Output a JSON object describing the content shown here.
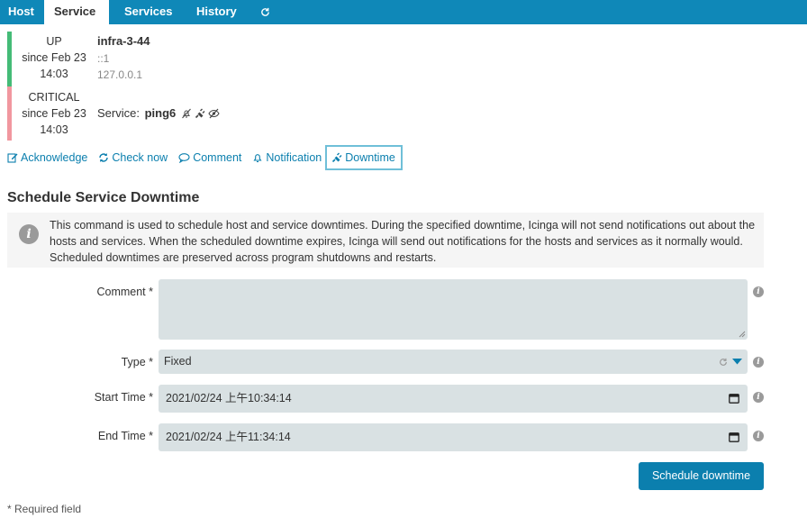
{
  "tabs": {
    "host": "Host",
    "service": "Service",
    "services": "Services",
    "history": "History"
  },
  "host_state": {
    "state": "UP",
    "since": "since Feb 23",
    "time": "14:03",
    "name": "infra-3-44",
    "address6": "::1",
    "address4": "127.0.0.1"
  },
  "service_state": {
    "state": "CRITICAL",
    "since": "since Feb 23",
    "time": "14:03",
    "prefix": "Service: ",
    "name": "ping6"
  },
  "actions": {
    "acknowledge": "Acknowledge",
    "check_now": "Check now",
    "comment": "Comment",
    "notification": "Notification",
    "downtime": "Downtime"
  },
  "form": {
    "title": "Schedule Service Downtime",
    "info": "This command is used to schedule host and service downtimes. During the specified downtime, Icinga will not send notifications out about the hosts and services. When the scheduled downtime expires, Icinga will send out notifications for the hosts and services as it normally would. Scheduled downtimes are preserved across program shutdowns and restarts.",
    "comment_label": "Comment *",
    "comment_value": "",
    "type_label": "Type *",
    "type_value": "Fixed",
    "start_label": "Start Time *",
    "start_value": "2021/02/24 上午10:34:14",
    "end_label": "End Time *",
    "end_value": "2021/02/24 上午11:34:14",
    "submit": "Schedule downtime",
    "required_note": "* Required field"
  },
  "colors": {
    "header": "#0f88b8",
    "link": "#0b7fae",
    "state_up": "#44bb77",
    "state_critical": "#f1979f",
    "field_bg": "#d9e1e3"
  },
  "icons": {
    "refresh": "refresh-icon",
    "acknowledge": "edit-icon",
    "check_now": "arrows-cycle-icon",
    "comment": "speech-bubble-icon",
    "notification": "bell-icon",
    "downtime": "plug-icon",
    "notifications_disabled": "bell-slash-icon",
    "in_downtime": "plug-icon",
    "flapping_hidden": "eye-slash-icon",
    "info": "info-icon",
    "calendar": "calendar-icon"
  }
}
